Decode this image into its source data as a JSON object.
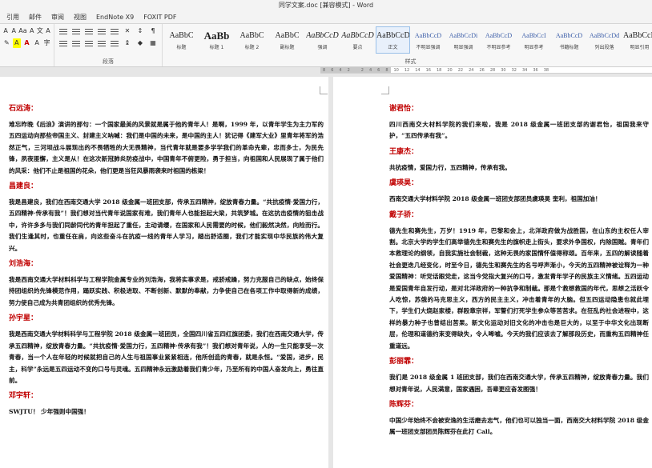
{
  "window": {
    "title": "同学文案.doc [兼容模式] - Word"
  },
  "tabs": [
    "引用",
    "邮件",
    "审阅",
    "视图",
    "EndNote X9",
    "FOXIT PDF"
  ],
  "ribbon": {
    "font_group_label": "",
    "para_group_label": "段落",
    "styles_group_label": "样式",
    "font_buttons_row1": [
      "A",
      "A",
      "Aa",
      "A",
      "文",
      "A"
    ],
    "font_buttons_row2": [
      "✎",
      "A",
      "A",
      "A",
      "字"
    ],
    "styles": [
      {
        "sample": "AaBbC",
        "name": "标题"
      },
      {
        "sample": "AaBb",
        "name": "标题 1"
      },
      {
        "sample": "AaBbC",
        "name": "标题 2"
      },
      {
        "sample": "AaBbC",
        "name": "副标题"
      },
      {
        "sample": "AaBbCcD",
        "name": "强调"
      },
      {
        "sample": "AaBbCcD",
        "name": "要点"
      },
      {
        "sample": "AaBbCcDd",
        "name": "正文"
      },
      {
        "sample": "AaBbCcD",
        "name": "不明显强调"
      },
      {
        "sample": "AaBbCcDi",
        "name": "明显强调"
      },
      {
        "sample": "AaBbCcD",
        "name": "不明显参考"
      },
      {
        "sample": "AaBbCcI",
        "name": "明显参考"
      },
      {
        "sample": "AaBbCcD",
        "name": "书籍标题"
      },
      {
        "sample": "AaBbCcDd",
        "name": "列出段落"
      },
      {
        "sample": "AaBbCcDd",
        "name": "明显引用"
      }
    ],
    "accent_color": "#2b579a"
  },
  "ruler": {
    "ticks": [
      "8",
      "6",
      "4",
      "2",
      "",
      "2",
      "4",
      "6",
      "8",
      "10",
      "12",
      "14",
      "16",
      "18",
      "20",
      "22",
      "24",
      "26",
      "28",
      "30",
      "32",
      "34",
      "36",
      "38"
    ]
  },
  "left_page": {
    "entries": [
      {
        "name": "石远涛：",
        "text": "难忘昨晚《后浪》演讲的那句：一个国家最美的风景就是属于他的青年人！是啊，1999 年，以青年学生为主力军的五四运动向那些帝国主义、封建主义呐喊：我们是中国的未来，是中国的主人！犹记得《建军大业》里青年将军的浩然正气，三河坝战斗展现出的不畏牺牲的大无畏精神，当代青年就是要多学学我们的革命先辈，忠而多士，为民先锋，夙夜匪懈，主义是从！在这次新冠肺炎防疫战中，中国青年不俯更险，勇于担当，向祖国和人民展现了属于他们的风采：他们不止是祖国的花朵，他们更是当狂风暴雨袭来时祖国的栋梁！"
      },
      {
        "name": "昌建良：",
        "text": "我是昌建良，我们在西南交通大学 2018 级金属一班团支部，传承五四精神，绽放青春力量。“共抗疫情·爱国力行，五四精神·传承有我”！我们想对当代青年说国家有难，我们青年人也能担起大梁，共筑梦城。在这抗击疫情的狙击战中，许许多多与我们同龄同代的青年担起了重任，主动请缨，在国家和人民需要的时候，他们毅然决然，向险而行。我们生逢其时，也重任在肩，向这些奋斗在抗疫一线的青年人学习，踏出舒适圈，我们才能实现中华民族的伟大复兴。"
      },
      {
        "name": "刘浩海：",
        "text": "我是西南交通大学材料科学与工程学院金属专业的刘浩海，我将实事求是，戒骄戒躁，努力克服自己的缺点，始终保持团组织的先锋模范作用，踊跃实践、积极进取、不断创新、默默的奉献，力争使自己在各项工作中取得新的成绩，努力使自己成为共青团组织的优秀先锋。"
      },
      {
        "name": "孙宇星：",
        "text": "我是西南交通大学材料科学与工程学院 2018 级金属一班团员，全国四川省五四红旗团委，我们在西南交通大学，传承五四精神，绽放青春力量。“共抗疫情·爱国力行，五四精神·传承有我”！我们想对青年说，人的一生只能享受一次青春，当一个人在年轻的时候就把自己的人生与祖国事业紧紧相连，他所创造的青春，就是永恒。“爱国，进步，民主，科学”永远是五四运动不变的口号与灵魂。五四精神永远激励着我们青少年，乃至所有的中国人奋发向上，勇往直前。"
      },
      {
        "name": "邓宇轩：",
        "text": "SWJTU！ 少年强则中国强！"
      }
    ]
  },
  "right_page": {
    "entries": [
      {
        "name": "谢君怡：",
        "text": "四川西南交大材料学院的我们来啦，我是 2018 级金属一班团支部的谢君怡，祖国我来守护，“五四传承有我”。"
      },
      {
        "name": "王康杰：",
        "text": "共抗疫情，爱国力行，五四精神，传承有我。"
      },
      {
        "name": "虞瑛昊：",
        "text": "西南交通大学材料学院 2018 级金属一班团支部团员虞瑛昊 奎利，祖国加油！"
      },
      {
        "name": "戴子骄：",
        "text": "德先生和赛先生，万岁！1919 年，巴黎和会上，北洋政府做为战胜国，在山东的主权任人宰割。北京大学的学生们高举德先生和赛先生的旗帜走上街头，要求外争国权，内除国贼。青年们本救理论的纲领，自我实施社会制裁，这种无畏的家国情怀值得称颂。百年来，五四的解读随着社会更迭几经变化，时至今日，德先生和赛先生的名号呼声渐小，今天的五四精神被诠释为一种爱国精神：听党话跟党走，这当今党指大复兴的口号，激发青年学子的民族主义情绪。五四运动是爱国青年自发行动，是对北洋政府的一种抗争和制裁。那是个救想救国的年代，思想之活跃令人吃惊，苏俄的马克思主义，西方的民主主义，冲击着青年的大脑。但五四运动隐患也就此埋下，学生们大烧赵家楼，群殴章宗祥，军警们打死学生参众等苦苦求。在狂乱的社会进程中，这样的暴力种子也曾结出苦果。新文化运动对旧文化的冲击也是巨大的，以至于中华文化出现断层，伦理和道德约束变得缺失，令人唏嘘。今天的我们应该去了解那段历史，而重构五四精神任重道远。"
      },
      {
        "name": "彭丽霏：",
        "text": "我们是 2018 级金属 1 班团支部，我们在西南交通大学，传承五四精神，绽放青春力量。我们想对青年说，人民满意，国家遇困，吾辈更应奋发图强！"
      },
      {
        "name": "陈辉芬：",
        "text": "中国少年始终不会被安逸的生活磨去志气，他们也可以独当一面，西南交大材料学院 2018 级金属一班团支部团员陈辉芬在此打 Call。"
      }
    ]
  }
}
